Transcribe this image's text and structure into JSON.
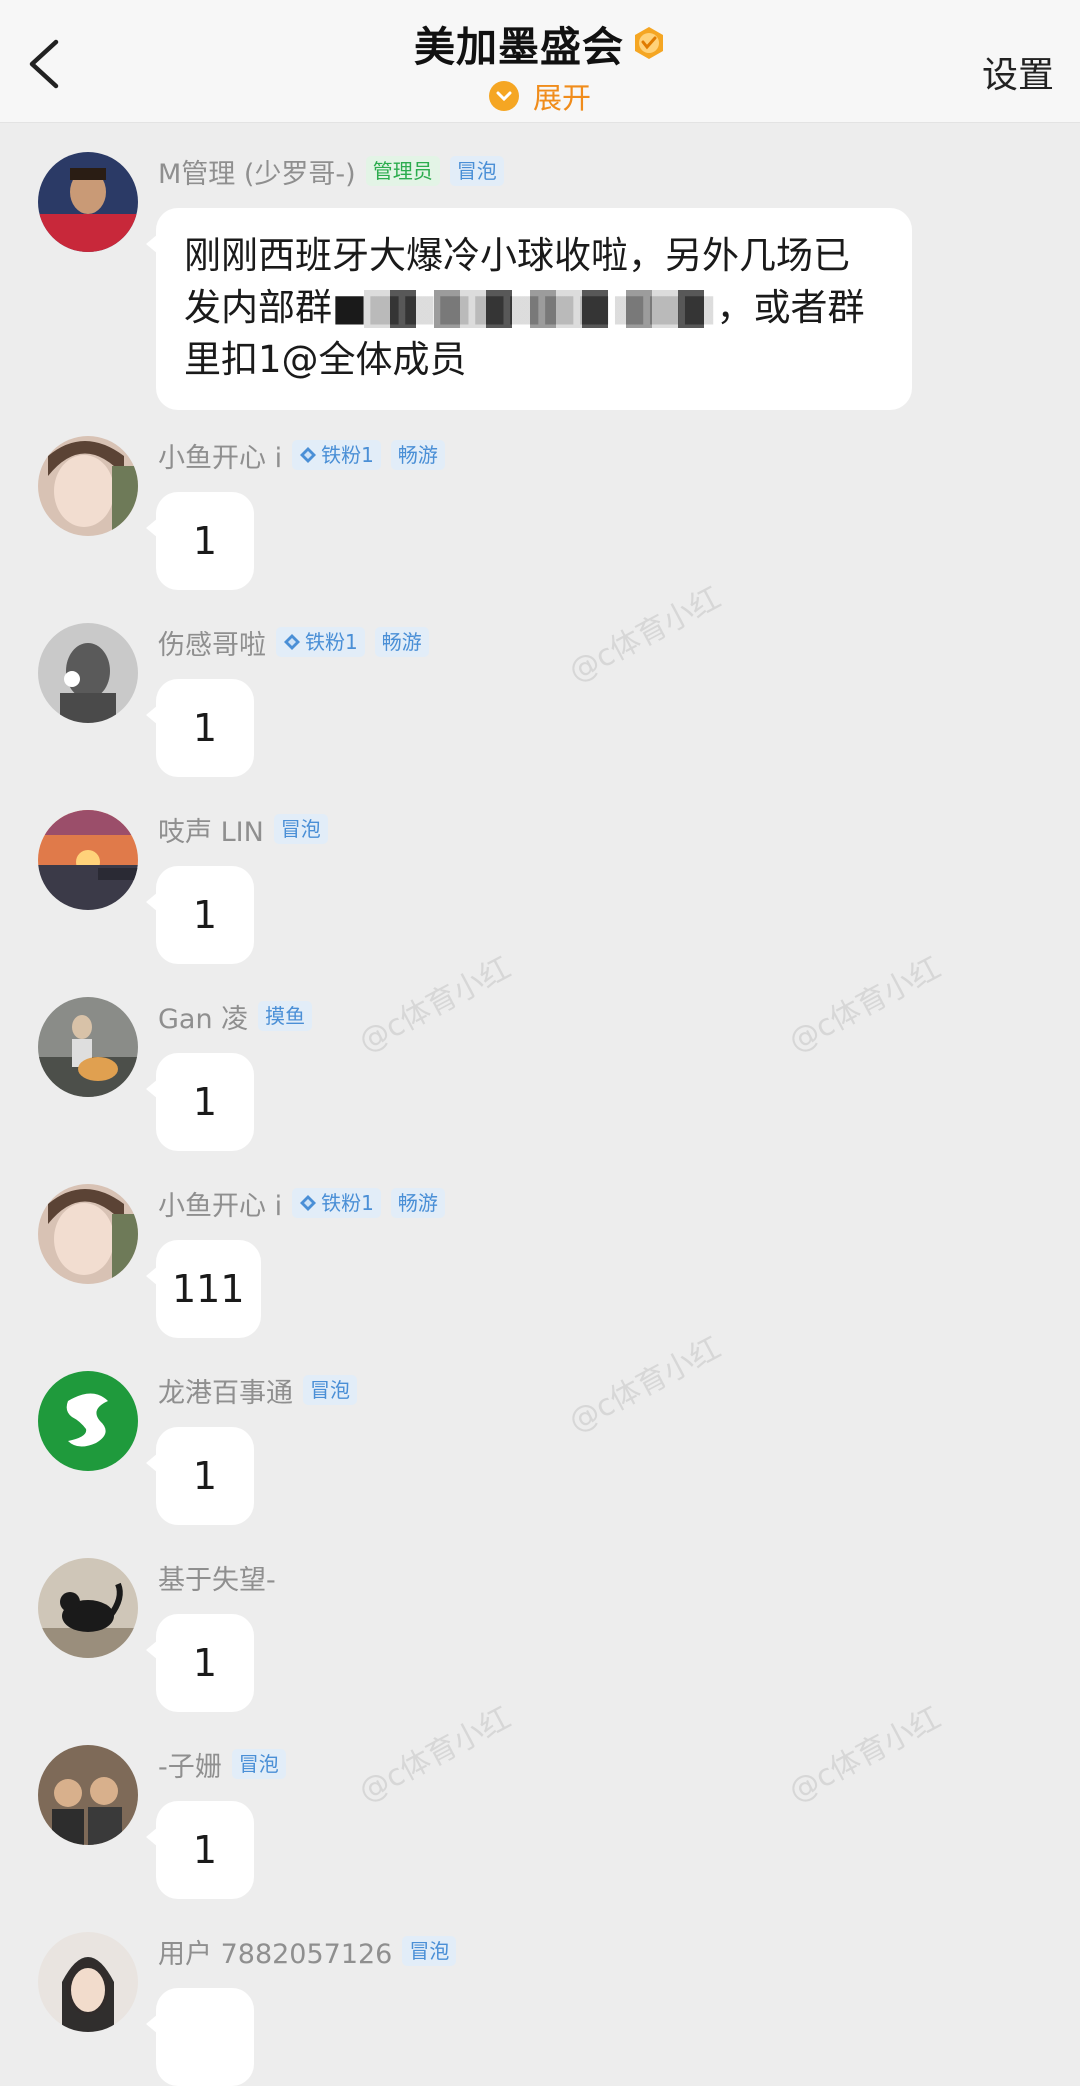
{
  "header": {
    "title": "美加墨盛会",
    "expand_label": "展开",
    "settings_label": "设置"
  },
  "colors": {
    "background": "#ededed",
    "accent": "#f5a623",
    "admin_badge": "#2cac4e",
    "level_badge": "#4a8fd6"
  },
  "messages": [
    {
      "name": "M管理 (少罗哥-)",
      "badges": [
        "管理员",
        "冒泡"
      ],
      "text_line1": "刚刚西班牙大爆冷小球收啦，另外几场已",
      "text_line2": "发内部群■■■■■■■■■■■，或者群",
      "text_line3": "里扣1@全体成员"
    },
    {
      "name": "小鱼开心 i",
      "badges": [
        "铁粉1",
        "畅游"
      ],
      "text": "1"
    },
    {
      "name": "伤感哥啦",
      "badges": [
        "铁粉1",
        "畅游"
      ],
      "text": "1"
    },
    {
      "name": "吱声 LIN",
      "badges": [
        "冒泡"
      ],
      "text": "1"
    },
    {
      "name": "Gan 凌",
      "badges": [
        "摸鱼"
      ],
      "text": "1"
    },
    {
      "name": "小鱼开心 i",
      "badges": [
        "铁粉1",
        "畅游"
      ],
      "text": "111"
    },
    {
      "name": "龙港百事通",
      "badges": [
        "冒泡"
      ],
      "text": "1"
    },
    {
      "name": "基于失望-",
      "badges": [],
      "text": "1"
    },
    {
      "name": "-子姗",
      "badges": [
        "冒泡"
      ],
      "text": "1"
    },
    {
      "name": "用户 7882057126",
      "badges": [
        "冒泡"
      ],
      "text": ""
    }
  ],
  "watermark_text": "@c体育小红"
}
